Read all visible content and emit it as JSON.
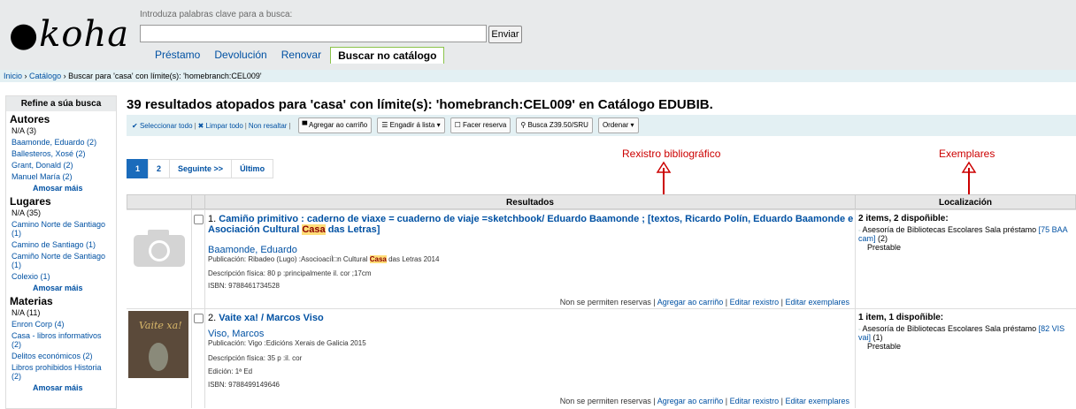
{
  "header": {
    "logo": "koha",
    "search_hint": "Introduza palabras clave para a busca:",
    "search_value": "",
    "search_button": "Enviar",
    "tabs": [
      "Préstamo",
      "Devolución",
      "Renovar",
      "Buscar no catálogo"
    ]
  },
  "breadcrumb": {
    "home": "Inicio",
    "catalog": "Catálogo",
    "current": "Buscar para 'casa' con límite(s): 'homebranch:CEL009'"
  },
  "sidebar": {
    "title": "Refine a súa busca",
    "groups": [
      {
        "label": "Autores",
        "items": [
          "N/A (3)",
          "Baamonde, Eduardo (2)",
          "Ballesteros, Xosé (2)",
          "Grant, Donald (2)",
          "Manuel María (2)"
        ],
        "more": "Amosar máis"
      },
      {
        "label": "Lugares",
        "items": [
          "N/A (35)",
          "Camino Norte de Santiago (1)",
          "Camino de Santiago (1)",
          "Camiño Norte de Santiago (1)",
          "Colexio (1)"
        ],
        "more": "Amosar máis"
      },
      {
        "label": "Materias",
        "items": [
          "N/A (11)",
          "Enron Corp (4)",
          "Casa - libros informativos (2)",
          "Delitos económicos (2)",
          "Libros prohibidos Historia (2)"
        ],
        "more": "Amosar máis"
      }
    ]
  },
  "results": {
    "heading": "39 resultados atopados para 'casa' con límite(s): 'homebranch:CEL009' en Catálogo EDUBIB.",
    "toolbar": {
      "select_all": "Seleccionar todo",
      "clear_all": "Limpar todo",
      "no_highlight": "Non resaltar",
      "add_cart": "Agregar ao carriño",
      "add_list": "Engadir á lista",
      "place_hold": "Facer reserva",
      "z3950": "Busca Z39.50/SRU",
      "sort": "Ordenar"
    },
    "pager": [
      "1",
      "2",
      "Seguinte >>",
      "Último"
    ],
    "annotations": {
      "record": "Rexistro bibliográfico",
      "items": "Exemplares"
    },
    "columns": {
      "results": "Resultados",
      "location": "Localización"
    },
    "rows": [
      {
        "number": "1.",
        "title_before": "Camiño primitivo : caderno de viaxe = cuaderno de viaje =sketchbook/ Eduardo Baamonde ; [textos, Ricardo Polín, Eduardo Baamonde e Asociación Cultural ",
        "title_hl": "Casa",
        "title_after": " das Letras]",
        "author": "Baamonde, Eduardo",
        "publication_label": "Publicación:",
        "publication_before": "Ribadeo (Lugo) :AsocioaciÌ□n Cultural ",
        "publication_hl": "Casa",
        "publication_after": " das Letras 2014",
        "description_label": "Descripción física:",
        "description": "80 p :principalmente il. cor ;17cm",
        "isbn_label": "ISBN:",
        "isbn": "9788461734528",
        "actions": [
          "Non se permiten reservas",
          "Agregar ao carriño",
          "Editar rexistro",
          "Editar exemplares"
        ],
        "availability": "2 items, 2 dispoñible:",
        "location": "Asesoría de Bibliotecas Escolares Sala préstamo",
        "callno": "[75 BAA cam]",
        "count": "(2)",
        "status": "Prestable"
      },
      {
        "number": "2.",
        "title_before": "Vaite xa! / Marcos Viso",
        "title_hl": "",
        "title_after": "",
        "cover_text": "Vaite xa!",
        "author": "Viso, Marcos",
        "publication_label": "Publicación:",
        "publication_before": "Vigo :Edicións Xerais de Galicia 2015",
        "publication_hl": "",
        "publication_after": "",
        "description_label": "Descripción física:",
        "description": "35 p :il. cor",
        "edition_label": "Edición:",
        "edition": "1ª Ed",
        "isbn_label": "ISBN:",
        "isbn": "9788499149646",
        "actions": [
          "Non se permiten reservas",
          "Agregar ao carriño",
          "Editar rexistro",
          "Editar exemplares"
        ],
        "availability": "1 item, 1 dispoñible:",
        "location": "Asesoría de Bibliotecas Escolares Sala préstamo",
        "callno": "[82 VIS vai]",
        "count": "(1)",
        "status": "Prestable"
      }
    ]
  }
}
